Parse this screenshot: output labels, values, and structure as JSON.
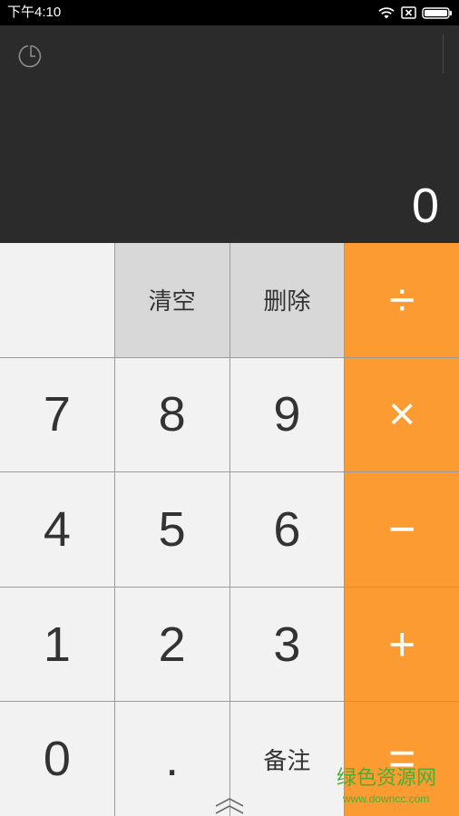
{
  "status_bar": {
    "time": "下午4:10",
    "icons": {
      "wifi": "wifi-icon",
      "sim": "no-sim-icon",
      "battery": "battery-icon"
    }
  },
  "display": {
    "value": "0",
    "history_icon": "history-clock-icon"
  },
  "keypad": {
    "rows": [
      [
        {},
        {
          "label": "清空"
        },
        {
          "label": "删除"
        },
        {
          "label": "÷"
        }
      ],
      [
        {
          "label": "7"
        },
        {
          "label": "8"
        },
        {
          "label": "9"
        },
        {
          "label": "×"
        }
      ],
      [
        {
          "label": "4"
        },
        {
          "label": "5"
        },
        {
          "label": "6"
        },
        {
          "label": "−"
        }
      ],
      [
        {
          "label": "1"
        },
        {
          "label": "2"
        },
        {
          "label": "3"
        },
        {
          "label": "+"
        }
      ],
      [
        {
          "label": "0"
        },
        {
          "label": "."
        },
        {
          "label": "备注"
        },
        {
          "label": "="
        }
      ]
    ]
  },
  "expand_icon": "double-chevron-up-icon",
  "watermark": {
    "name": "绿色资源网",
    "url": "www.downcc.com"
  },
  "colors": {
    "status_bg": "#000000",
    "display_bg": "#2b2b2b",
    "number_key_bg": "#f2f2f2",
    "function_key_bg": "#d8d8d8",
    "operator_key_bg": "#fd9b33",
    "key_text": "#333333",
    "operator_text": "#ffffff",
    "watermark": "#45b035"
  }
}
